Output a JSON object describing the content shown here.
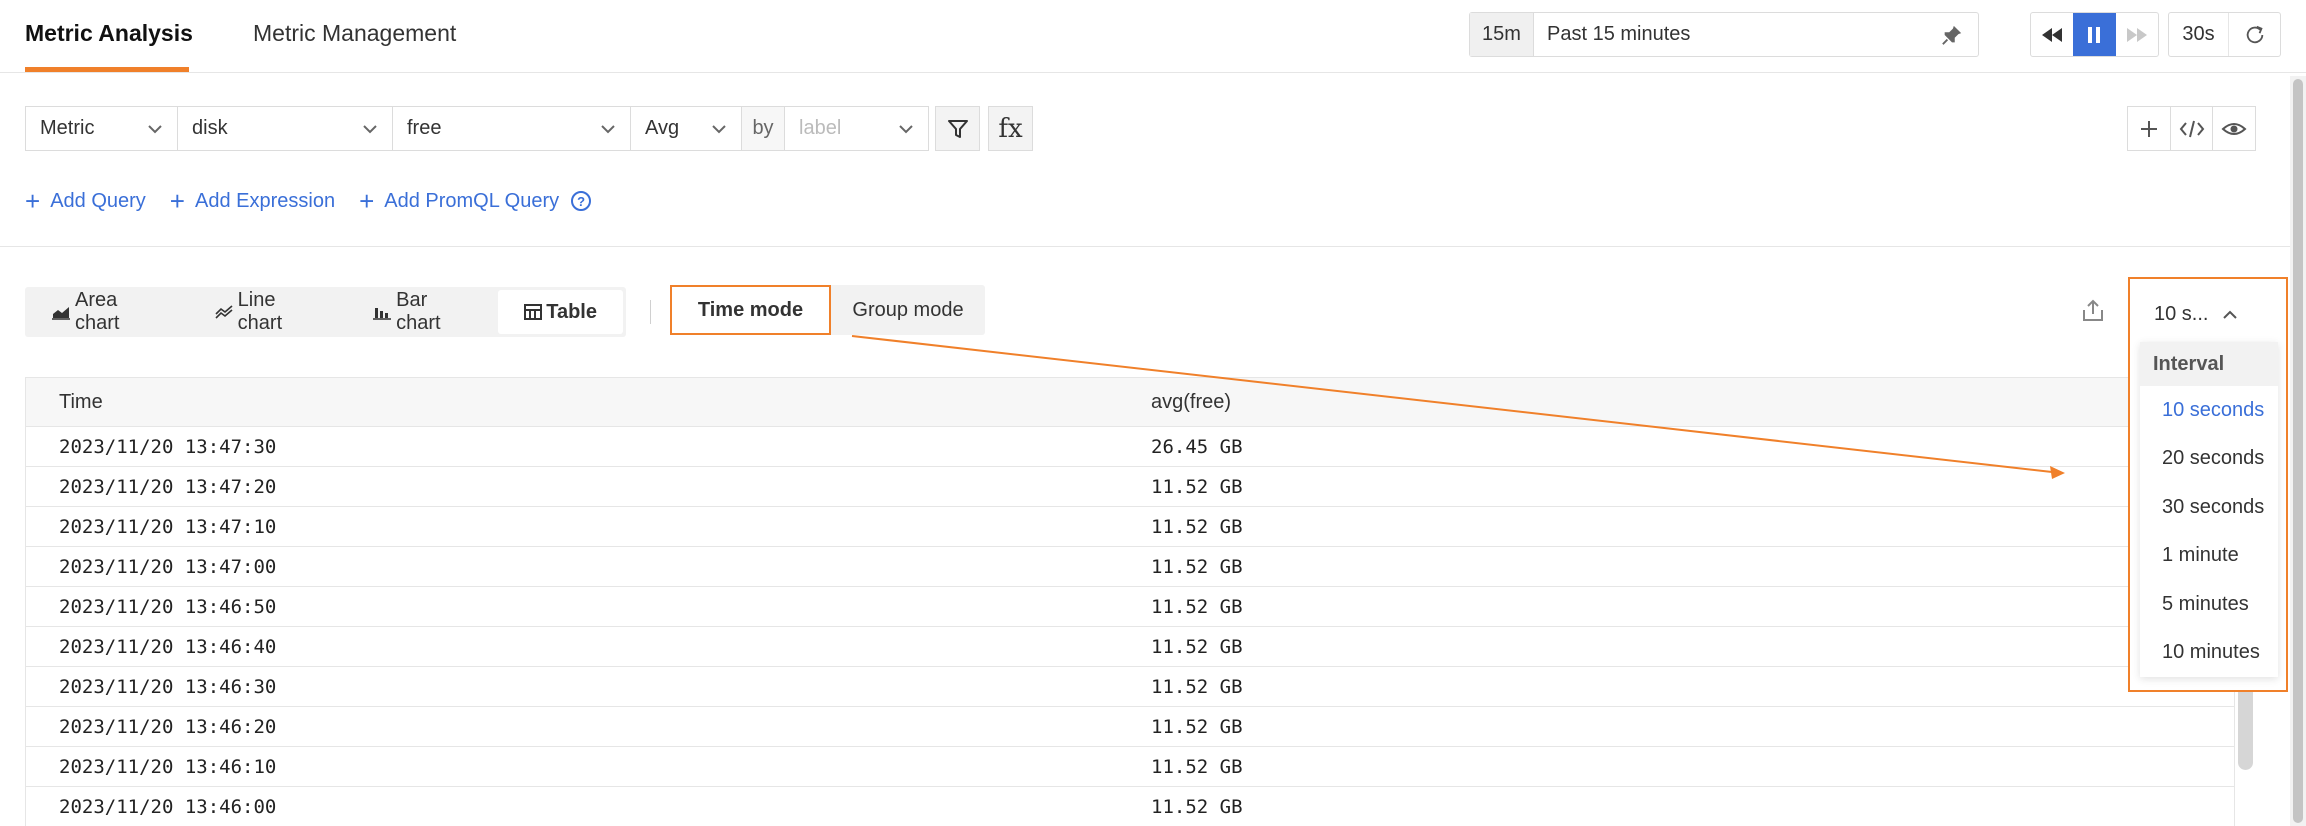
{
  "nav": {
    "tabs": [
      {
        "label": "Metric Analysis",
        "active": true
      },
      {
        "label": "Metric Management",
        "active": false
      }
    ]
  },
  "time_picker": {
    "badge": "15m",
    "range": "Past 15 minutes"
  },
  "refresh": {
    "interval": "30s"
  },
  "query": {
    "type": "Metric",
    "metric": "disk",
    "field": "free",
    "aggregation": "Avg",
    "by_label": "by",
    "group_placeholder": "label",
    "fx": "fx"
  },
  "add_links": {
    "add_query": "Add Query",
    "add_expression": "Add Expression",
    "add_promql": "Add PromQL Query"
  },
  "chart_types": [
    "Area chart",
    "Line chart",
    "Bar chart",
    "Table"
  ],
  "active_chart_type": "Table",
  "modes": {
    "time": "Time mode",
    "group": "Group mode",
    "active": "Time mode"
  },
  "interval": {
    "current": "10 s...",
    "menu_title": "Interval",
    "options": [
      "10 seconds",
      "20 seconds",
      "30 seconds",
      "1 minute",
      "5 minutes",
      "10 minutes"
    ],
    "selected": "10 seconds"
  },
  "table": {
    "columns": [
      "Time",
      "avg(free)"
    ],
    "rows": [
      [
        "2023/11/20 13:47:30",
        "26.45 GB"
      ],
      [
        "2023/11/20 13:47:20",
        "11.52 GB"
      ],
      [
        "2023/11/20 13:47:10",
        "11.52 GB"
      ],
      [
        "2023/11/20 13:47:00",
        "11.52 GB"
      ],
      [
        "2023/11/20 13:46:50",
        "11.52 GB"
      ],
      [
        "2023/11/20 13:46:40",
        "11.52 GB"
      ],
      [
        "2023/11/20 13:46:30",
        "11.52 GB"
      ],
      [
        "2023/11/20 13:46:20",
        "11.52 GB"
      ],
      [
        "2023/11/20 13:46:10",
        "11.52 GB"
      ],
      [
        "2023/11/20 13:46:00",
        "11.52 GB"
      ]
    ]
  },
  "colors": {
    "accent": "#3a6fd8",
    "highlight": "#f0802a"
  }
}
